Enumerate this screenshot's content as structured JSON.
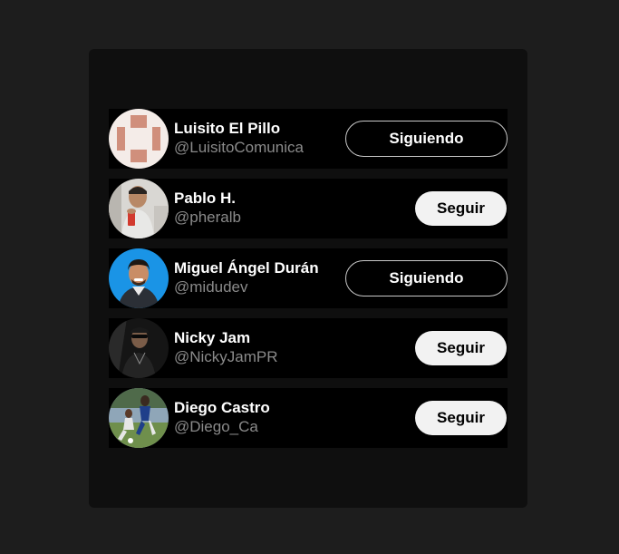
{
  "users": [
    {
      "name": "Luisito El Pillo",
      "handle": "@LuisitoComunica",
      "button_label": "Siguiendo",
      "following": true,
      "avatar_icon": "default-avatar-icon"
    },
    {
      "name": "Pablo H.",
      "handle": "@pheralb",
      "button_label": "Seguir",
      "following": false,
      "avatar_icon": "person-photo"
    },
    {
      "name": "Miguel Ángel Durán",
      "handle": "@midudev",
      "button_label": "Siguiendo",
      "following": true,
      "avatar_icon": "person-photo"
    },
    {
      "name": "Nicky Jam",
      "handle": "@NickyJamPR",
      "button_label": "Seguir",
      "following": false,
      "avatar_icon": "person-photo"
    },
    {
      "name": "Diego Castro",
      "handle": "@Diego_Ca",
      "button_label": "Seguir",
      "following": false,
      "avatar_icon": "person-photo"
    }
  ],
  "colors": {
    "page_background": "#1d1d1d",
    "panel_background": "#0f0f0f",
    "card_background": "#000000",
    "handle_text": "#8a8a8a",
    "follow_button_bg": "#f2f2f2",
    "following_border": "#c9c9c9"
  }
}
